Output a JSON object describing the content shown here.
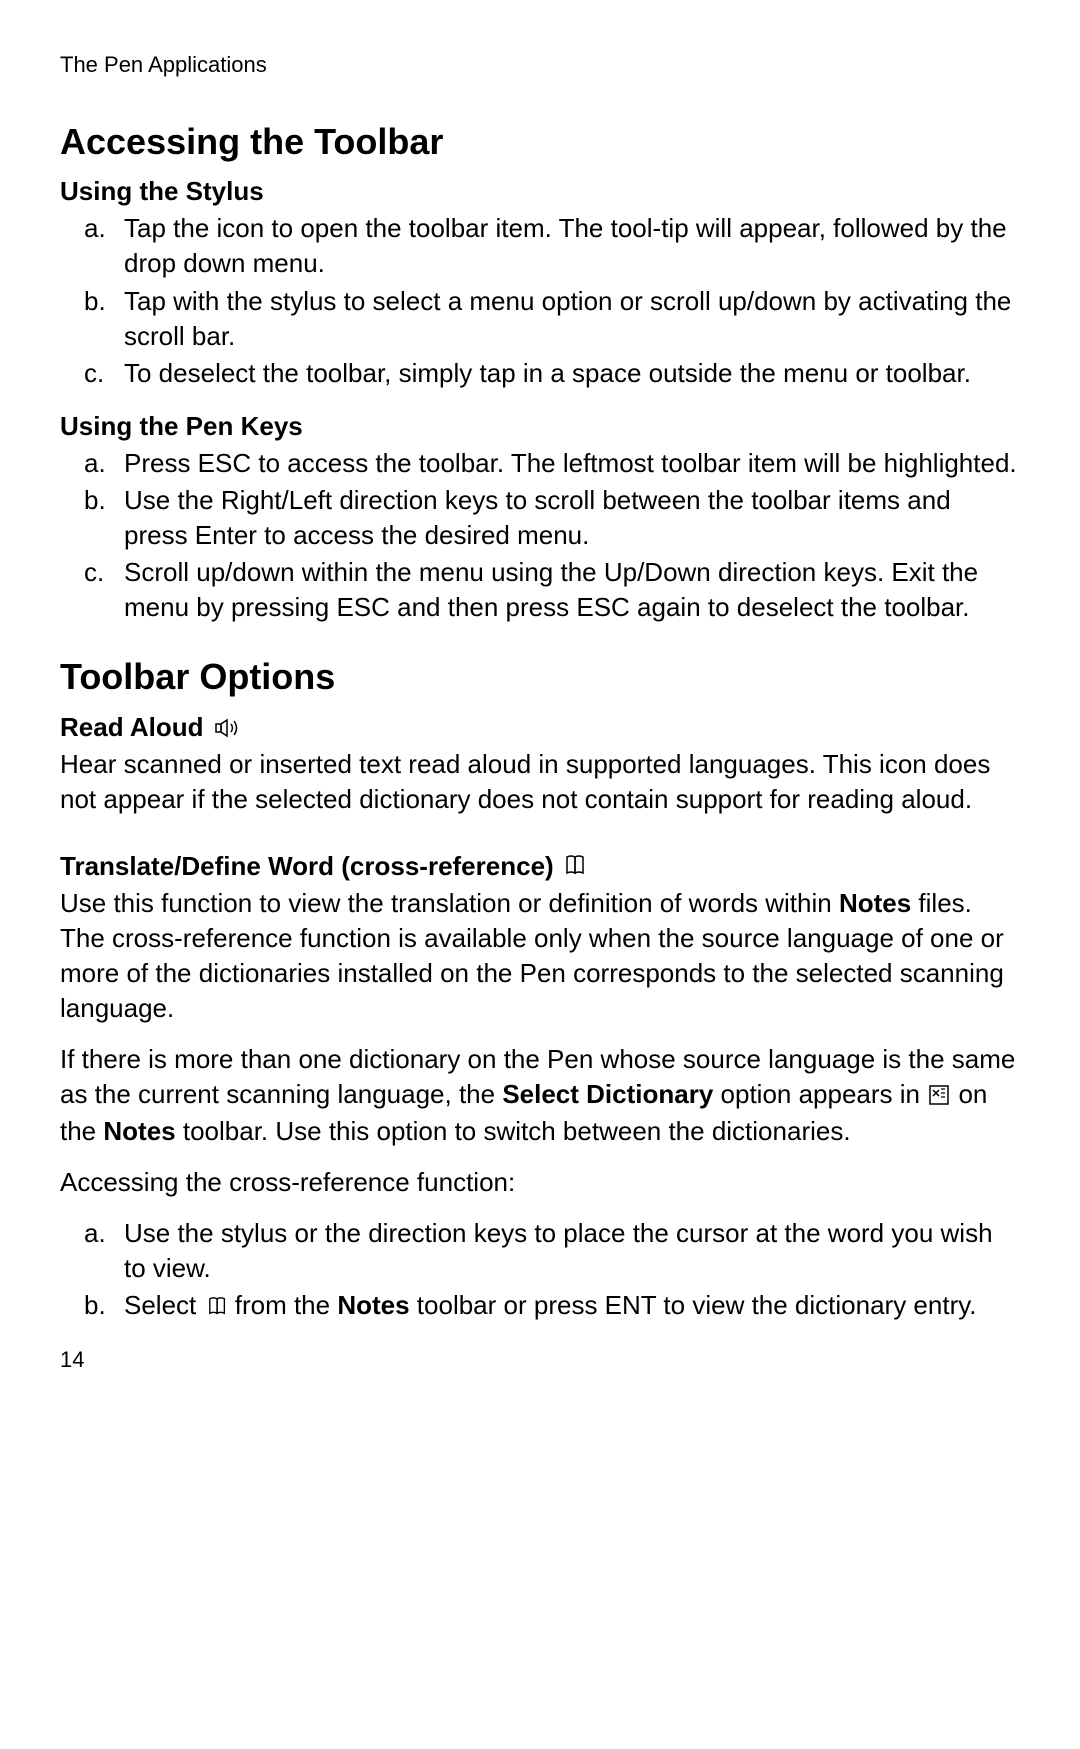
{
  "header": "The Pen Applications",
  "h1": "Accessing the Toolbar",
  "stylus": {
    "title": "Using the Stylus",
    "items": [
      "Tap the icon to open the toolbar item. The tool-tip will appear, followed by the drop down menu.",
      "Tap with the stylus to select a menu option or scroll up/down by activating the scroll bar.",
      "To deselect the toolbar, simply tap in a space outside the menu or toolbar."
    ]
  },
  "penkeys": {
    "title": "Using the Pen Keys",
    "items": [
      "Press ESC to access the toolbar. The leftmost toolbar item will be highlighted.",
      "Use the Right/Left direction keys to scroll between the toolbar items and press Enter to access the desired menu.",
      "Scroll up/down within the menu using the Up/Down direction keys. Exit the menu by pressing ESC and then press ESC again to deselect the toolbar."
    ]
  },
  "h2": "Toolbar Options",
  "readaloud": {
    "title": "Read Aloud",
    "body": "Hear scanned or inserted text read aloud in supported languages. This icon does not appear if the selected dictionary does not contain support for reading aloud."
  },
  "translate": {
    "title": "Translate/Define Word (cross-reference)",
    "p1a": "Use this function to view the translation or definition of words within ",
    "p1b_bold": "Notes",
    "p1c": " files. The cross-reference function is available only when the source language of one or more of the dictionaries installed on the Pen corresponds to the selected scanning language.",
    "p2a": "If there is more than one dictionary on the Pen whose source language is the same as the current scanning language, the ",
    "p2b_bold": "Select Dictionary",
    "p2c": " option appears in ",
    "p2d": " on the ",
    "p2e_bold": "Notes",
    "p2f": " toolbar. Use this option to switch between the dictionaries.",
    "p3": "Accessing the cross-reference function:",
    "steps": {
      "a": "Use the stylus or the direction keys to place the cursor at the word you wish to view.",
      "b_pre": "Select ",
      "b_mid": " from the ",
      "b_bold": "Notes",
      "b_post": " toolbar or press ENT to view the dictionary entry."
    }
  },
  "pageNumber": "14"
}
